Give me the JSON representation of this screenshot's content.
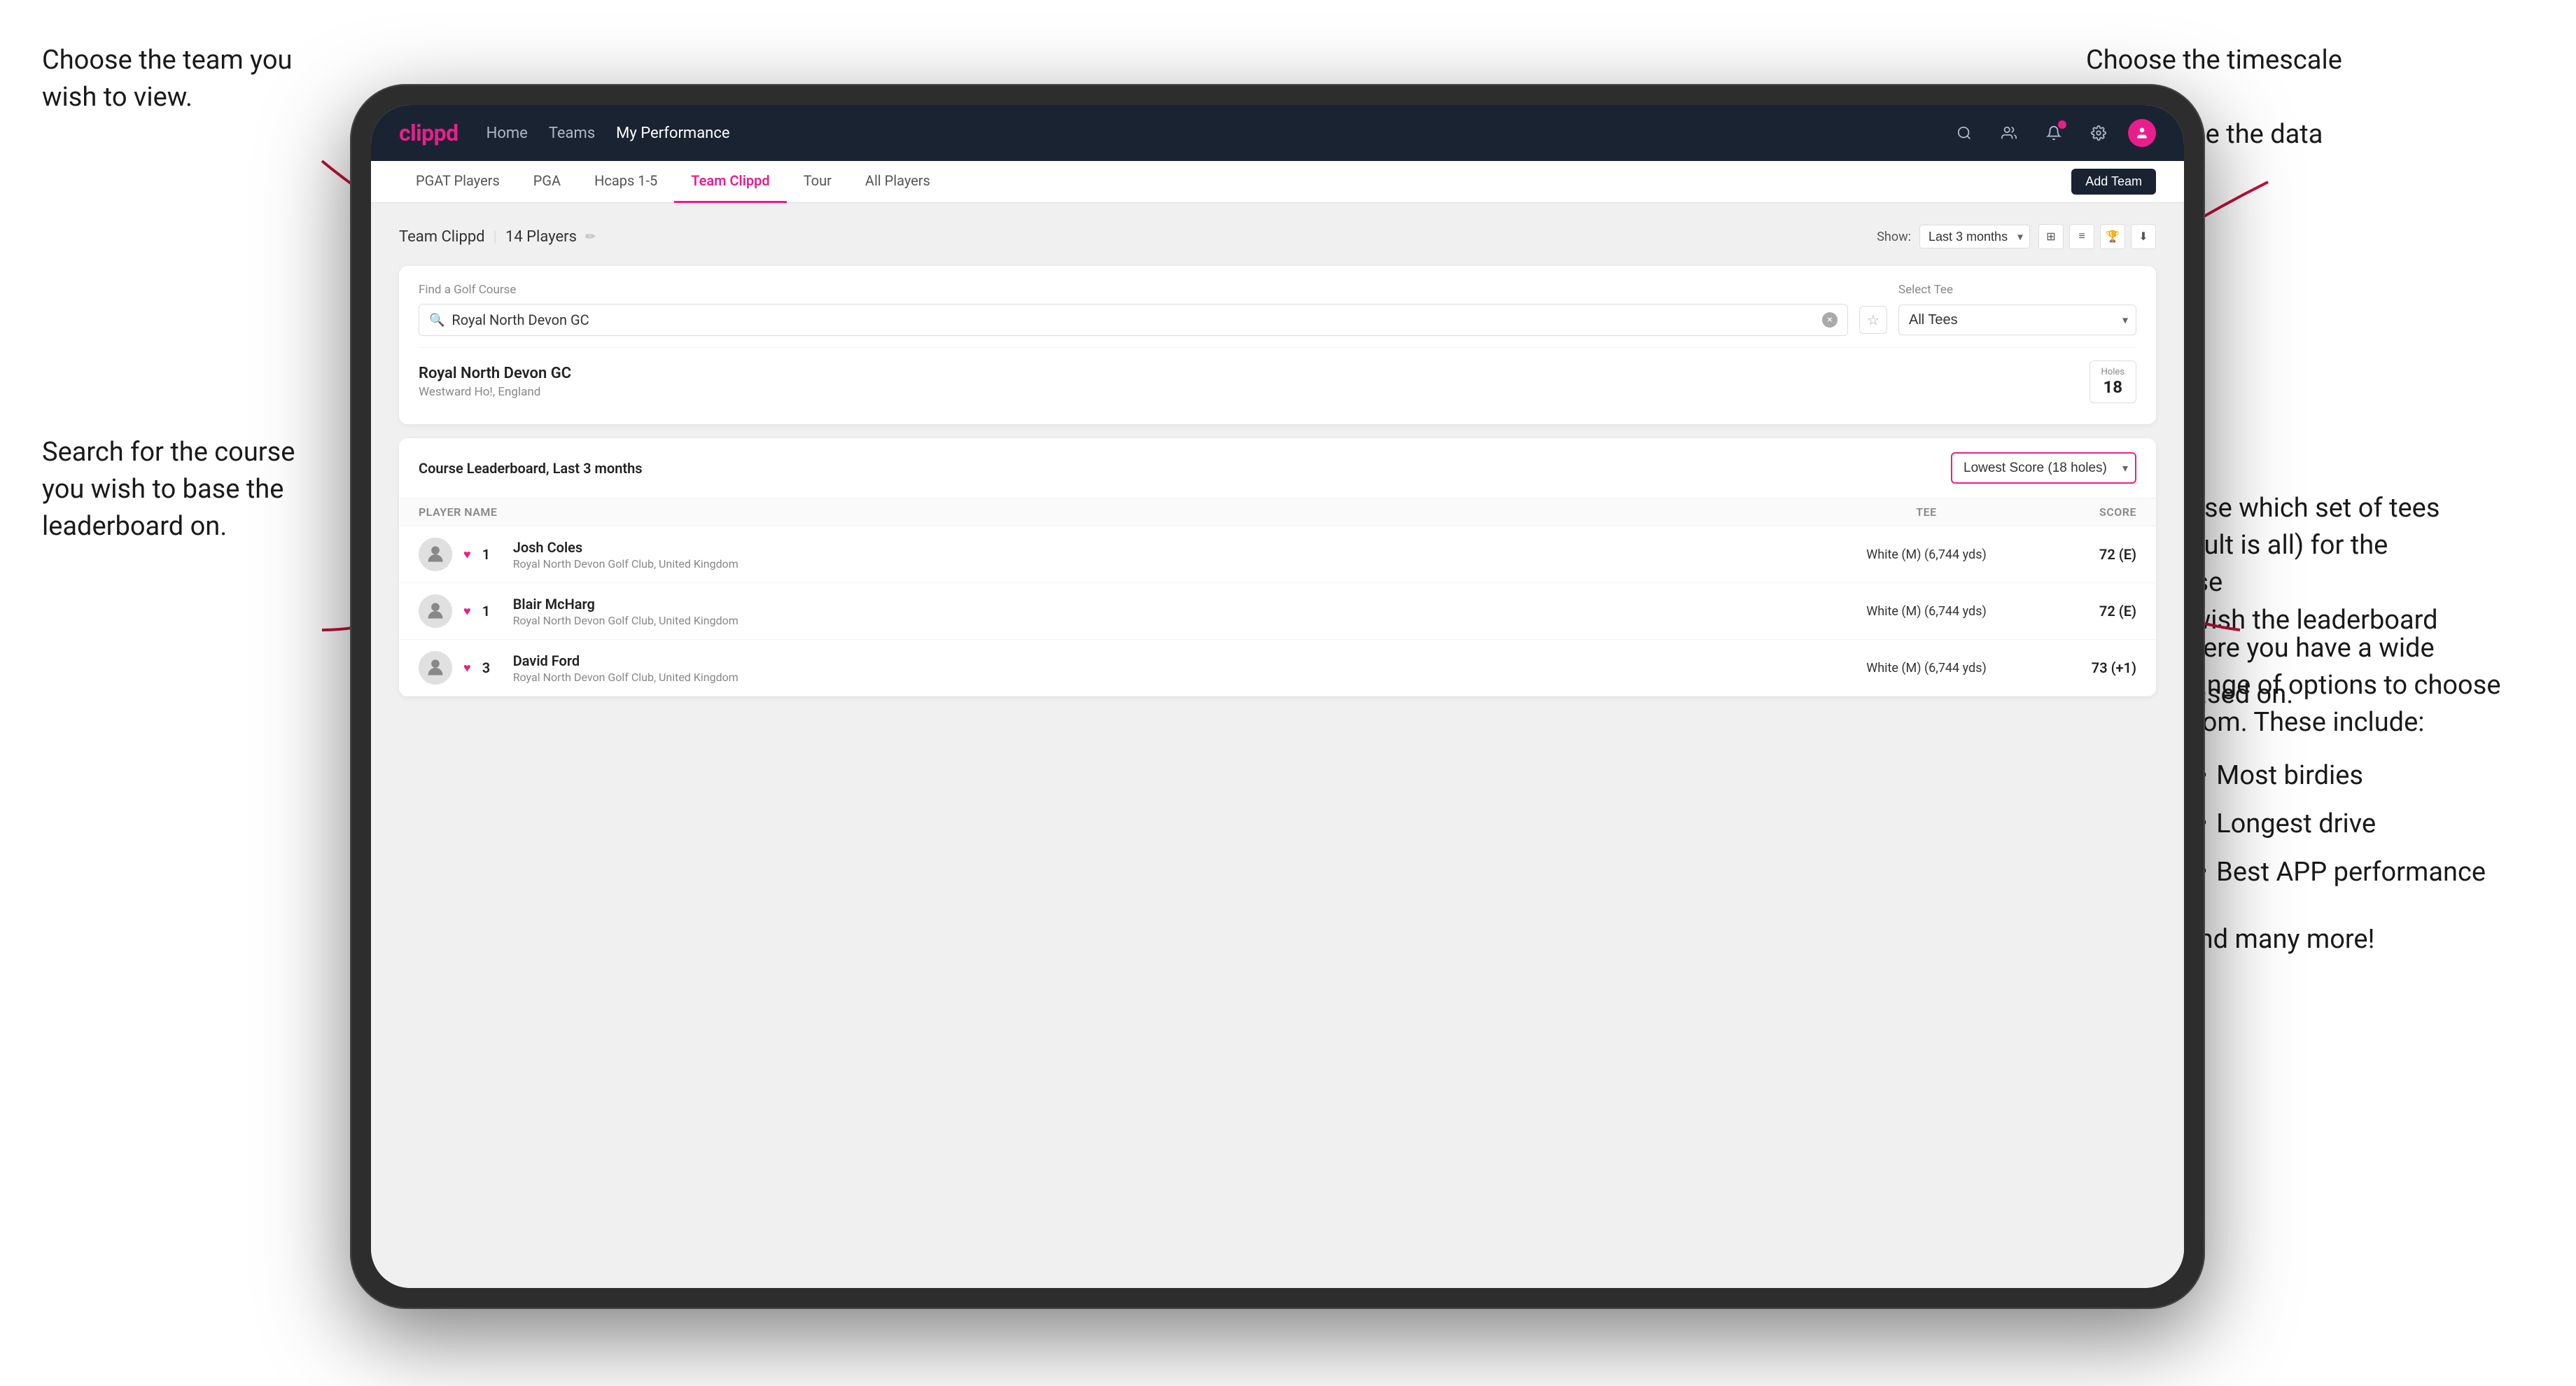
{
  "annotations": {
    "top_left": {
      "line1": "Choose the team you",
      "line2": "wish to view."
    },
    "top_right": {
      "line1": "Choose the timescale you",
      "line2": "wish to see the data over."
    },
    "mid_left": {
      "line1": "Search for the course",
      "line2": "you wish to base the",
      "line3": "leaderboard on."
    },
    "mid_right": {
      "line1": "Choose which set of tees",
      "line2": "(default is all) for the course",
      "line3": "you wish the leaderboard to",
      "line4": "be based on."
    },
    "bottom_right": {
      "intro": "Here you have a wide range of options to choose from. These include:",
      "bullets": [
        "Most birdies",
        "Longest drive",
        "Best APP performance"
      ],
      "footer": "and many more!"
    }
  },
  "nav": {
    "logo": "clippd",
    "links": [
      {
        "label": "Home",
        "active": false
      },
      {
        "label": "Teams",
        "active": false
      },
      {
        "label": "My Performance",
        "active": true
      }
    ]
  },
  "tabs": {
    "items": [
      {
        "label": "PGAT Players",
        "active": false
      },
      {
        "label": "PGA",
        "active": false
      },
      {
        "label": "Hcaps 1-5",
        "active": false
      },
      {
        "label": "Team Clippd",
        "active": true
      },
      {
        "label": "Tour",
        "active": false
      },
      {
        "label": "All Players",
        "active": false
      }
    ],
    "add_team_label": "Add Team"
  },
  "team_header": {
    "title": "Team Clippd",
    "count": "14 Players",
    "show_label": "Show:",
    "show_value": "Last 3 months"
  },
  "search": {
    "find_label": "Find a Golf Course",
    "placeholder": "Royal North Devon GC",
    "tee_label": "Select Tee",
    "tee_value": "All Tees"
  },
  "course": {
    "name": "Royal North Devon GC",
    "location": "Westward Ho!, England",
    "holes_label": "Holes",
    "holes_value": "18"
  },
  "leaderboard": {
    "title": "Course Leaderboard,",
    "period": "Last 3 months",
    "score_type": "Lowest Score (18 holes)",
    "cols": {
      "player": "PLAYER NAME",
      "tee": "TEE",
      "score": "SCORE"
    },
    "rows": [
      {
        "rank": "1",
        "name": "Josh Coles",
        "club": "Royal North Devon Golf Club, United Kingdom",
        "tee": "White (M) (6,744 yds)",
        "score": "72 (E)"
      },
      {
        "rank": "1",
        "name": "Blair McHarg",
        "club": "Royal North Devon Golf Club, United Kingdom",
        "tee": "White (M) (6,744 yds)",
        "score": "72 (E)"
      },
      {
        "rank": "3",
        "name": "David Ford",
        "club": "Royal North Devon Golf Club, United Kingdom",
        "tee": "White (M) (6,744 yds)",
        "score": "73 (+1)"
      }
    ]
  },
  "colors": {
    "brand_pink": "#e91e8c",
    "nav_bg": "#1a2332",
    "tab_active": "#e91e8c"
  }
}
